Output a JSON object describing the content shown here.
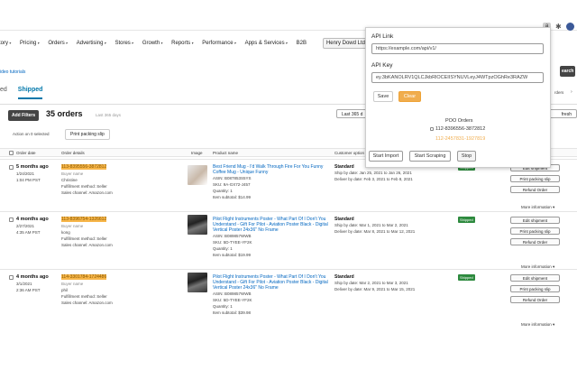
{
  "toolbar": {
    "extension_letter": "a"
  },
  "nav": {
    "items": [
      "tory",
      "Pricing",
      "Orders",
      "Advertising",
      "Stores",
      "Growth",
      "Reports",
      "Performance",
      "Apps & Services",
      "B2B"
    ],
    "store_chip": "Henry Dowd Ltd"
  },
  "page": {
    "video_link": "ideo tutorials",
    "search_button": "earch",
    "tabs": [
      "ed",
      "Shipped"
    ],
    "add_filters": "Add Filters",
    "orders_count": "35 orders",
    "orders_range": "Last 365 days",
    "last_days_btn": "Last 365 d",
    "action_text": "Action on 0 selected",
    "print_packing": "Print packing slip",
    "orders_right": "rders",
    "refresh_right": "fresh"
  },
  "table": {
    "headers": [
      "Order date",
      "Order details",
      "Image",
      "Product name",
      "Customer option"
    ],
    "rows": [
      {
        "age": "5 months ago",
        "date": "1/24/2021",
        "time": "1:04 PM PST",
        "order_id": "113-8395556-3872812",
        "buyer_label": "Buyer name",
        "buyer": "Christine",
        "fulfillment": "Fulfillment method: Seller",
        "channel": "Sales channel: Amazon.com",
        "product": "Best Friend Mug - I'd Walk Through Fire For You Funny",
        "product2": "Coffee Mug - Unique Funny",
        "asin": "ASIN: B087853S5YS",
        "sku": "SKU: 9A-GX72-J457",
        "qty": "Quantity: 1",
        "subtotal": "Item subtotal: $14.99",
        "service": "Standard",
        "ship": "Ship by date: Jan 25, 2021 to Jan 26, 2021",
        "deliver": "Deliver by date: Feb 3, 2021 to Feb 8, 2021",
        "status": "Shipped",
        "actions": [
          "Edit shipment",
          "Print packing slip",
          "Refund Order"
        ]
      },
      {
        "age": "4 months ago",
        "date": "2/27/2021",
        "time": "4:35 AM PST",
        "order_id": "113-8396754-1326612",
        "buyer_label": "Buyer name",
        "buyer": "kong",
        "fulfillment": "Fulfillment method: Seller",
        "channel": "Sales channel: Amazon.com",
        "product": "Pilot Flight Instruments Poster - What Part Of I Don't You",
        "product2": "Understand - Gift For Pilot - Aviation Poster Black - Digital",
        "product3": "Vertical Poster 24x36\" No Frame",
        "asin": "ASIN: B089857WWB",
        "sku": "SKU: 5D-TYEE-YF2K",
        "qty": "Quantity: 1",
        "subtotal": "Item subtotal: $19.99",
        "service": "Standard",
        "ship": "Ship by date: Mar 1, 2021 to Mar 2, 2021",
        "deliver": "Deliver by date: Mar 8, 2021 to Mar 12, 2021",
        "status": "Shipped",
        "actions": [
          "Edit shipment",
          "Print packing slip",
          "Refund Order"
        ]
      },
      {
        "age": "4 months ago",
        "date": "3/1/2021",
        "time": "2:36 AM PST",
        "order_id": "114-3301784-1724486",
        "buyer_label": "Buyer name",
        "buyer": "phil",
        "fulfillment": "Fulfillment method: Seller",
        "channel": "Sales channel: Amazon.com",
        "product": "Pilot Flight Instruments Poster - What Part Of I Don't You",
        "product2": "Understand - Gift For Pilot - Aviation Poster Black - Digital",
        "product3": "Vertical Poster 24x36\" No Frame",
        "asin": "ASIN: B089857WWB",
        "sku": "SKU: 5D-TYEE-YF2K",
        "qty": "Quantity: 1",
        "subtotal": "Item subtotal: $39.98",
        "service": "Standard",
        "ship": "Ship by date: Mar 2, 2021 to Mar 3, 2021",
        "deliver": "Deliver by date: Mar 9, 2021 to Mar 15, 2021",
        "status": "Shipped",
        "actions": [
          "Edit shipment",
          "Print packing slip",
          "Refund Order"
        ]
      }
    ],
    "more_info": "More information"
  },
  "popup": {
    "api_link_label": "API Link",
    "api_link_value": "https://example.com/api/v1/",
    "api_key_label": "API Key",
    "api_key_value": "ey.3bKANOLRV1QLCJkbRlOCEIISYNUVLeyJ4WTpzOGhRe3RAZW",
    "save": "Save",
    "clear": "Clear",
    "poo_title": "POO Orders",
    "poo_order": "112-8396556-3872812",
    "poo_order2": "112-2457831-1927819",
    "start_import": "Start Import",
    "start_scraping": "Start Scraping",
    "stop": "Stop",
    "accent": "#f0ad4e"
  }
}
